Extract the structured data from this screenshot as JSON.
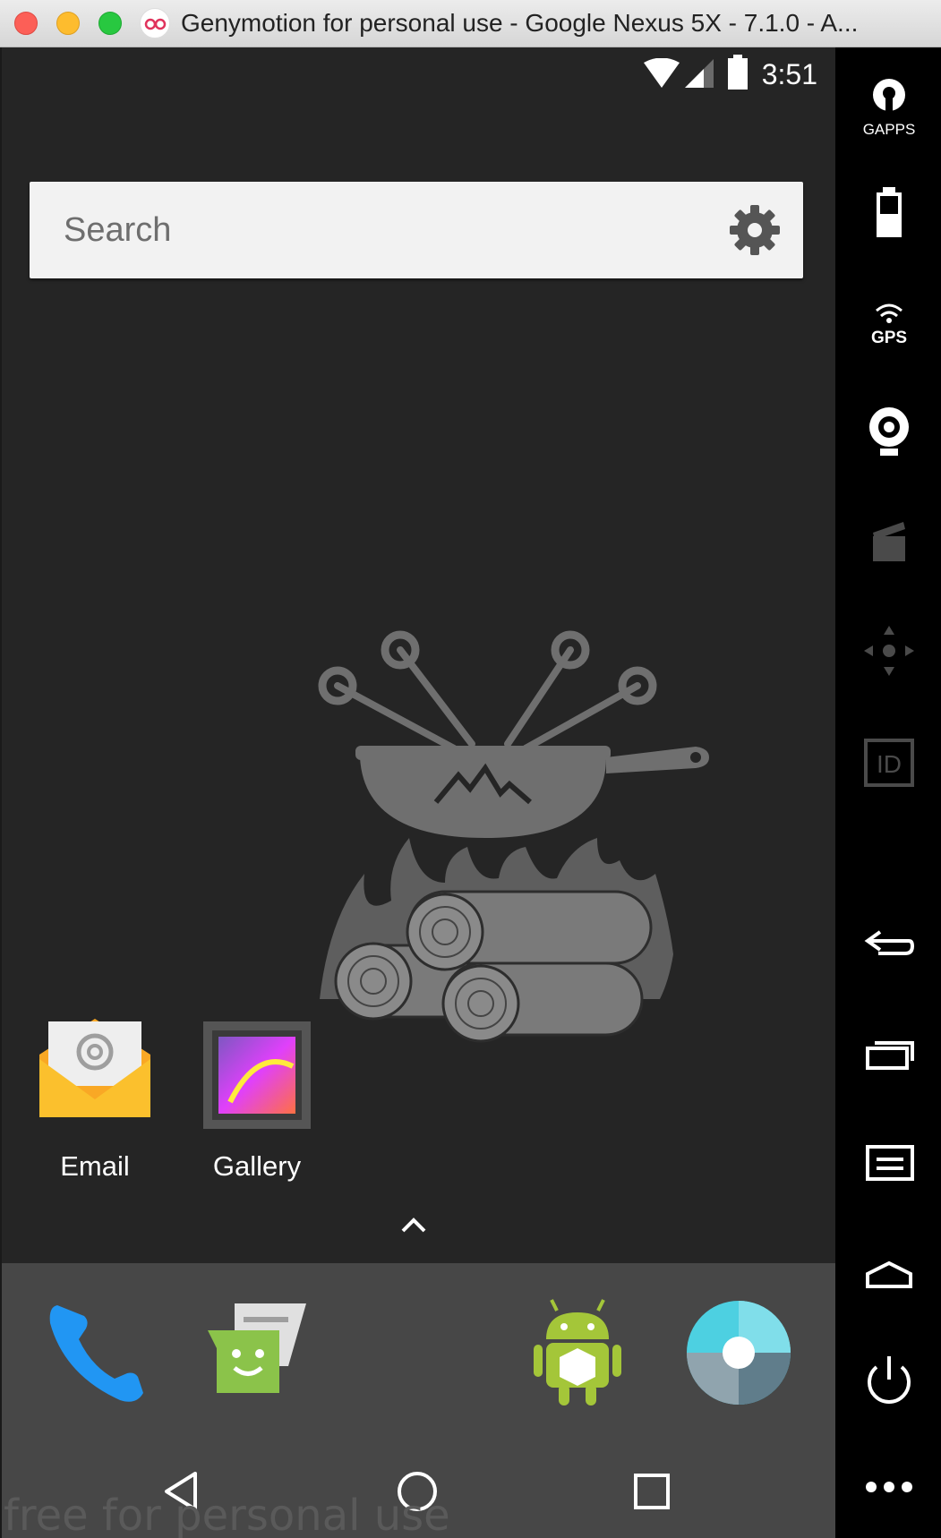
{
  "window": {
    "title": "Genymotion for personal use - Google Nexus 5X - 7.1.0 - A..."
  },
  "status": {
    "time": "3:51"
  },
  "search": {
    "placeholder": "Search"
  },
  "desktop": {
    "apps": [
      {
        "label": "Email",
        "icon": "email-icon"
      },
      {
        "label": "Gallery",
        "icon": "gallery-icon"
      }
    ]
  },
  "dock": {
    "apps": [
      {
        "name": "phone-icon"
      },
      {
        "name": "messenger-icon"
      },
      {
        "name": "api-demos-icon"
      },
      {
        "name": "camera-icon"
      }
    ]
  },
  "nav": {
    "buttons": [
      "back-icon",
      "home-icon",
      "recents-icon"
    ]
  },
  "watermark": "free for personal use",
  "sidebar": {
    "gapps_label": "GAPPS",
    "gps_label": "GPS",
    "id_label": "ID",
    "tools": [
      "gapps-icon",
      "battery-icon",
      "gps-icon",
      "webcam-icon",
      "capture-icon",
      "dpad-icon",
      "device-id-icon",
      "back-icon",
      "recent-apps-icon",
      "menu-icon",
      "home-icon",
      "power-icon",
      "more-icon"
    ]
  },
  "colors": {
    "accent_email": "#F9C22E",
    "gallery": "#E040FB",
    "phone": "#2196F3",
    "android": "#A4C639"
  }
}
